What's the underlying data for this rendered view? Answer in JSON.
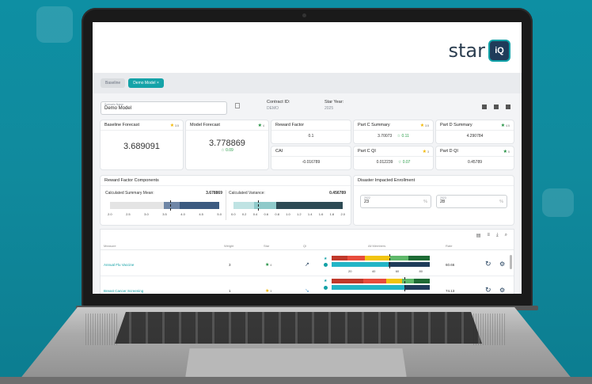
{
  "app": {
    "logo_text": "star",
    "logo_badge": "iQ"
  },
  "tabs": [
    {
      "label": "Baseline"
    },
    {
      "label": "Demo Model",
      "close": "×"
    }
  ],
  "scenario": {
    "field_label": "Scenario Name",
    "field_value": "Demo Model",
    "contract_label": "Contract ID:",
    "contract_value": "DEMO",
    "year_label": "Star Year:",
    "year_value": "2025"
  },
  "cards": {
    "baseline_forecast": {
      "title": "Baseline Forecast",
      "star": "3.5",
      "value": "3.689091"
    },
    "model_forecast": {
      "title": "Model Forecast",
      "star": "4",
      "value": "3.778869",
      "delta": "0.09"
    },
    "reward_factor": {
      "title": "Reward Factor",
      "value": "0.1"
    },
    "cai": {
      "title": "CAI",
      "value": "-0.016789"
    },
    "part_c_summary": {
      "title": "Part C Summary",
      "star": "3.5",
      "value": "3.70073",
      "delta": "0.11"
    },
    "part_d_summary": {
      "title": "Part D Summary",
      "star": "4.5",
      "value": "4.290784"
    },
    "part_c_qi": {
      "title": "Part C QI",
      "star": "3",
      "value": "0.012239",
      "delta": "0.07"
    },
    "part_d_qi": {
      "title": "Part D QI",
      "star": "5",
      "value": "0.45789"
    }
  },
  "reward_components": {
    "title": "Reward Factor Components",
    "mean_label": "Calculated Summary Mean:",
    "mean_value": "3.678869",
    "var_label": "Calculated Variance:",
    "var_value": "0.456789",
    "mean_ticks": [
      "2.0",
      "2.5",
      "3.0",
      "3.5",
      "4.0",
      "4.5",
      "5.0"
    ],
    "var_ticks": [
      "0.0",
      "0.2",
      "0.4",
      "0.6",
      "0.8",
      "1.0",
      "1.2",
      "1.4",
      "1.6",
      "1.8",
      "2.0"
    ]
  },
  "disaster": {
    "title": "Disaster Impacted Enrollment",
    "fields": [
      {
        "year": "2022",
        "value": "23",
        "unit": "%"
      },
      {
        "year": "2023",
        "value": "28",
        "unit": "%"
      }
    ]
  },
  "table": {
    "headers": [
      "Measure",
      "Weight",
      "Star",
      "QI",
      "All Members",
      "Rate"
    ],
    "axis_ticks": [
      "20",
      "40",
      "60",
      "80"
    ],
    "rows": [
      {
        "measure": "Annual Flu Vaccine",
        "weight": "3",
        "star": "4",
        "qi": "↗",
        "rate": "60.66"
      },
      {
        "measure": "Breast Cancer Screening",
        "weight": "1",
        "star": "3",
        "qi": "↘",
        "rate": "74.13"
      }
    ]
  },
  "colors": {
    "teal": "#15a3a8",
    "navy": "#1f3c5a",
    "green_star": "#1e8e3e",
    "yellow_star": "#f2b600"
  }
}
